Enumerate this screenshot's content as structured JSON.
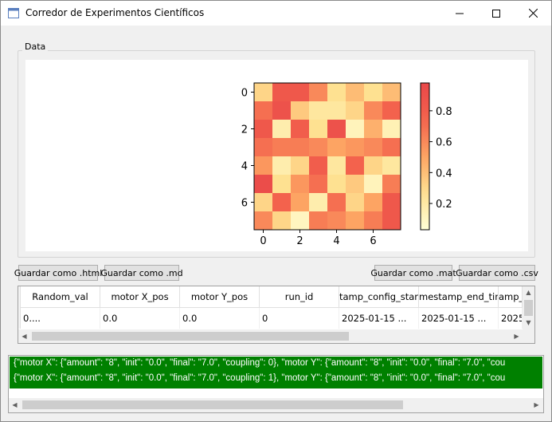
{
  "window": {
    "title": "Corredor de Experimentos Científicos",
    "icons": {
      "minimize": "minimize-icon",
      "maximize": "maximize-icon",
      "close": "close-icon"
    }
  },
  "data_group": {
    "label": "Data"
  },
  "chart_data": {
    "type": "heatmap",
    "rows": 8,
    "cols": 8,
    "x_ticks": [
      "0",
      "2",
      "4",
      "6"
    ],
    "y_ticks": [
      "0",
      "2",
      "4",
      "6"
    ],
    "colorbar_ticks": [
      "0.8",
      "0.6",
      "0.4",
      "0.2"
    ],
    "colorbar_range": [
      0.0,
      1.0
    ],
    "colormap": "YlOrRd",
    "values": [
      [
        0.3,
        0.85,
        0.85,
        0.6,
        0.25,
        0.4,
        0.25,
        0.4
      ],
      [
        0.7,
        0.9,
        0.35,
        0.2,
        0.2,
        0.3,
        0.6,
        0.75
      ],
      [
        0.85,
        0.15,
        0.8,
        0.25,
        0.9,
        0.1,
        0.45,
        0.12
      ],
      [
        0.7,
        0.65,
        0.65,
        0.6,
        0.5,
        0.55,
        0.6,
        0.7
      ],
      [
        0.55,
        0.15,
        0.3,
        0.8,
        0.2,
        0.75,
        0.3,
        0.2
      ],
      [
        0.95,
        0.25,
        0.55,
        0.7,
        0.25,
        0.35,
        0.1,
        0.65
      ],
      [
        0.3,
        0.75,
        0.5,
        0.15,
        0.7,
        0.3,
        0.5,
        0.85
      ],
      [
        0.6,
        0.3,
        0.08,
        0.65,
        0.6,
        0.5,
        0.65,
        0.85
      ]
    ]
  },
  "buttons": {
    "save_html": "Guardar como .html",
    "save_md": "Guardar como .md",
    "save_mat": "Guardar como .mat",
    "save_csv": "Guardar como .csv"
  },
  "table": {
    "headers": [
      "Random_val",
      "motor X_pos",
      "motor Y_pos",
      "run_id",
      "tamp_config_start",
      "mestamp_end_tim",
      "amp_"
    ],
    "row": [
      "0....",
      "0.0",
      "0.0",
      "0",
      "2025-01-15 ...",
      "2025-01-15 ...",
      "2025"
    ]
  },
  "log": {
    "lines": [
      "{\"motor X\": {\"amount\": \"8\", \"init\": \"0.0\", \"final\": \"7.0\", \"coupling\": 0}, \"motor Y\": {\"amount\": \"8\", \"init\": \"0.0\", \"final\": \"7.0\", \"cou",
      "{\"motor X\": {\"amount\": \"8\", \"init\": \"0.0\", \"final\": \"7.0\", \"coupling\": 1}, \"motor Y\": {\"amount\": \"8\", \"init\": \"0.0\", \"final\": \"7.0\", \"cou"
    ],
    "color": "#008000"
  }
}
